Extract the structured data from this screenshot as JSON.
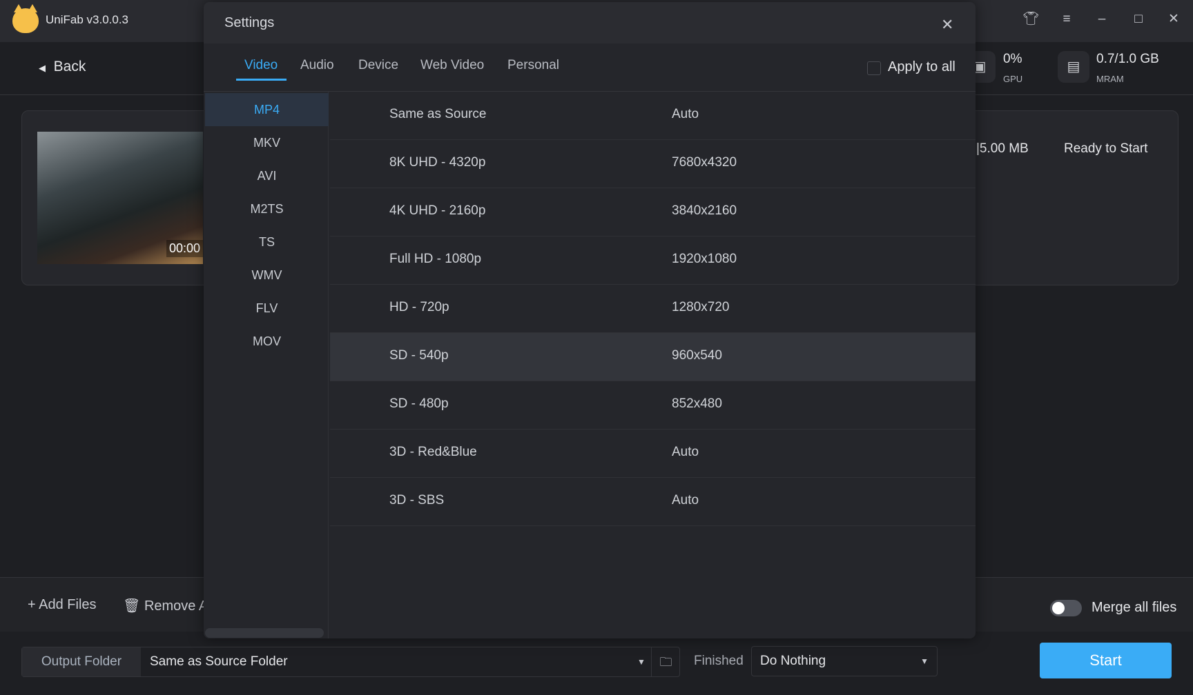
{
  "app": {
    "title": "UniFab v3.0.0.3",
    "back_label": "Back"
  },
  "titlebar_icons": [
    "shirt-icon",
    "menu-icon",
    "minimize-icon",
    "maximize-icon",
    "close-icon"
  ],
  "stats": {
    "gpu_value": "0%",
    "gpu_label": "GPU",
    "mram_value": "0.7/1.0 GB",
    "mram_label": "MRAM"
  },
  "file": {
    "time": "00:00",
    "size": "|5.00 MB",
    "status": "Ready to Start"
  },
  "toolbar": {
    "add_files": "Add Files",
    "remove": "Remove A",
    "merge_label": "Merge all files",
    "merge_on": false
  },
  "output": {
    "label": "Output Folder",
    "value": "Same as Source Folder",
    "finished_label": "Finished",
    "finished_value": "Do Nothing",
    "start": "Start"
  },
  "dialog": {
    "title": "Settings",
    "tabs": [
      {
        "label": "Video",
        "active": true
      },
      {
        "label": "Audio"
      },
      {
        "label": "Device"
      },
      {
        "label": "Web Video"
      },
      {
        "label": "Personal"
      }
    ],
    "apply_to_all": "Apply to all",
    "apply_checked": false,
    "formats": [
      "MP4",
      "MKV",
      "AVI",
      "M2TS",
      "TS",
      "WMV",
      "FLV",
      "MOV"
    ],
    "selected_format": "MP4",
    "resolutions": [
      {
        "name": "Same as Source",
        "value": "Auto"
      },
      {
        "name": "8K UHD - 4320p",
        "value": "7680x4320"
      },
      {
        "name": "4K UHD - 2160p",
        "value": "3840x2160"
      },
      {
        "name": "Full HD - 1080p",
        "value": "1920x1080"
      },
      {
        "name": "HD - 720p",
        "value": "1280x720"
      },
      {
        "name": "SD - 540p",
        "value": "960x540"
      },
      {
        "name": "SD - 480p",
        "value": "852x480"
      },
      {
        "name": "3D - Red&Blue",
        "value": "Auto"
      },
      {
        "name": "3D - SBS",
        "value": "Auto"
      }
    ],
    "selected_resolution": "SD - 540p"
  },
  "colors": {
    "accent": "#3aacf6",
    "background": "#1e1f23"
  }
}
